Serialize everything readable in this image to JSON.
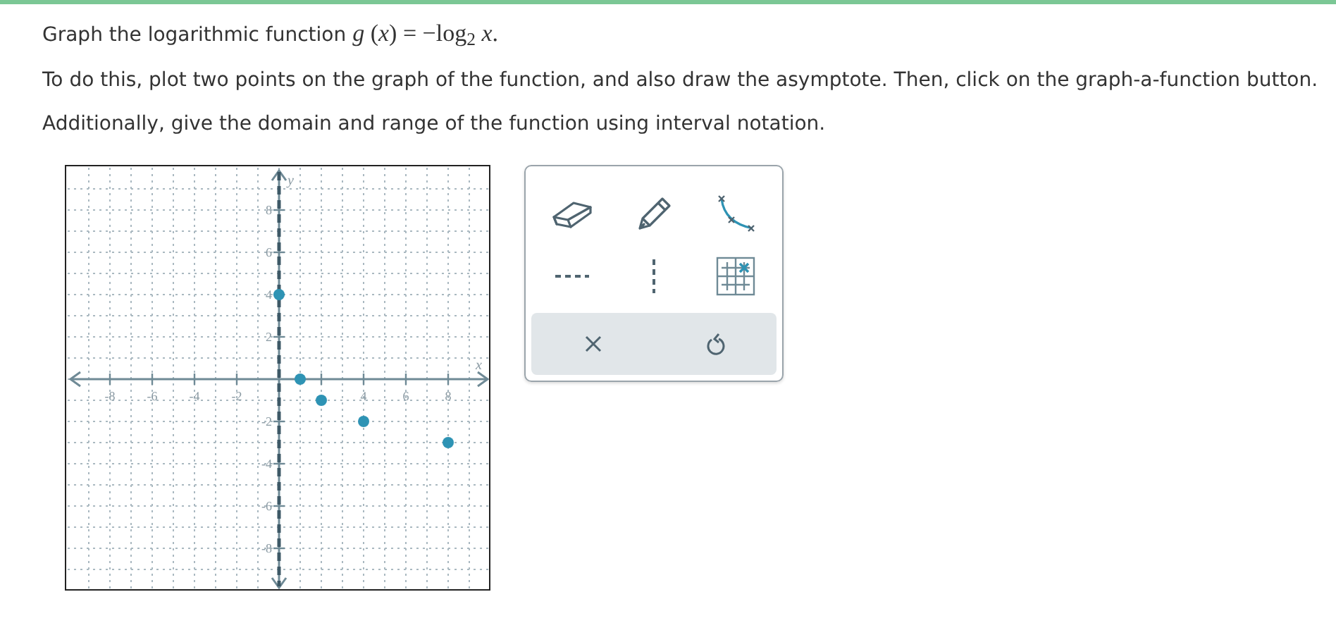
{
  "question": {
    "intro": "Graph the logarithmic function",
    "formula": "*g* (*x*) = −log$_{2}$ *x*.",
    "lines": [
      "To do this, plot two points on the graph of the function, and also draw the asymptote. Then, click on the graph-a-function button.",
      "Additionally, give the domain and range of the function using interval notation."
    ]
  },
  "graph": {
    "chart_data": {
      "type": "scatter",
      "xlabel": "x",
      "ylabel": "y",
      "xlim": [
        -10,
        10
      ],
      "ylim": [
        -10,
        10
      ],
      "grid": true,
      "xticks": [
        -8,
        -6,
        -4,
        -2,
        4,
        6,
        8
      ],
      "yticks": [
        8,
        6,
        4,
        2,
        -2,
        -4,
        -6,
        -8
      ],
      "x": [
        0,
        1,
        2,
        4,
        8
      ],
      "series": [
        {
          "color": "#2e93b4",
          "values": [
            4,
            0,
            -1,
            -2,
            -3
          ]
        }
      ],
      "ref_lines": [
        {
          "axis": "x",
          "value": 0,
          "color": "#3d5866"
        }
      ]
    }
  },
  "toolbar": {
    "tools": [
      {
        "kind": "eraser"
      },
      {
        "kind": "pencil"
      },
      {
        "kind": "curve"
      },
      {
        "kind": "horizontal-dashed"
      },
      {
        "kind": "vertical-dashed"
      },
      {
        "kind": "grid"
      }
    ],
    "actions": [
      {
        "kind": "clear"
      },
      {
        "kind": "undo"
      }
    ]
  }
}
